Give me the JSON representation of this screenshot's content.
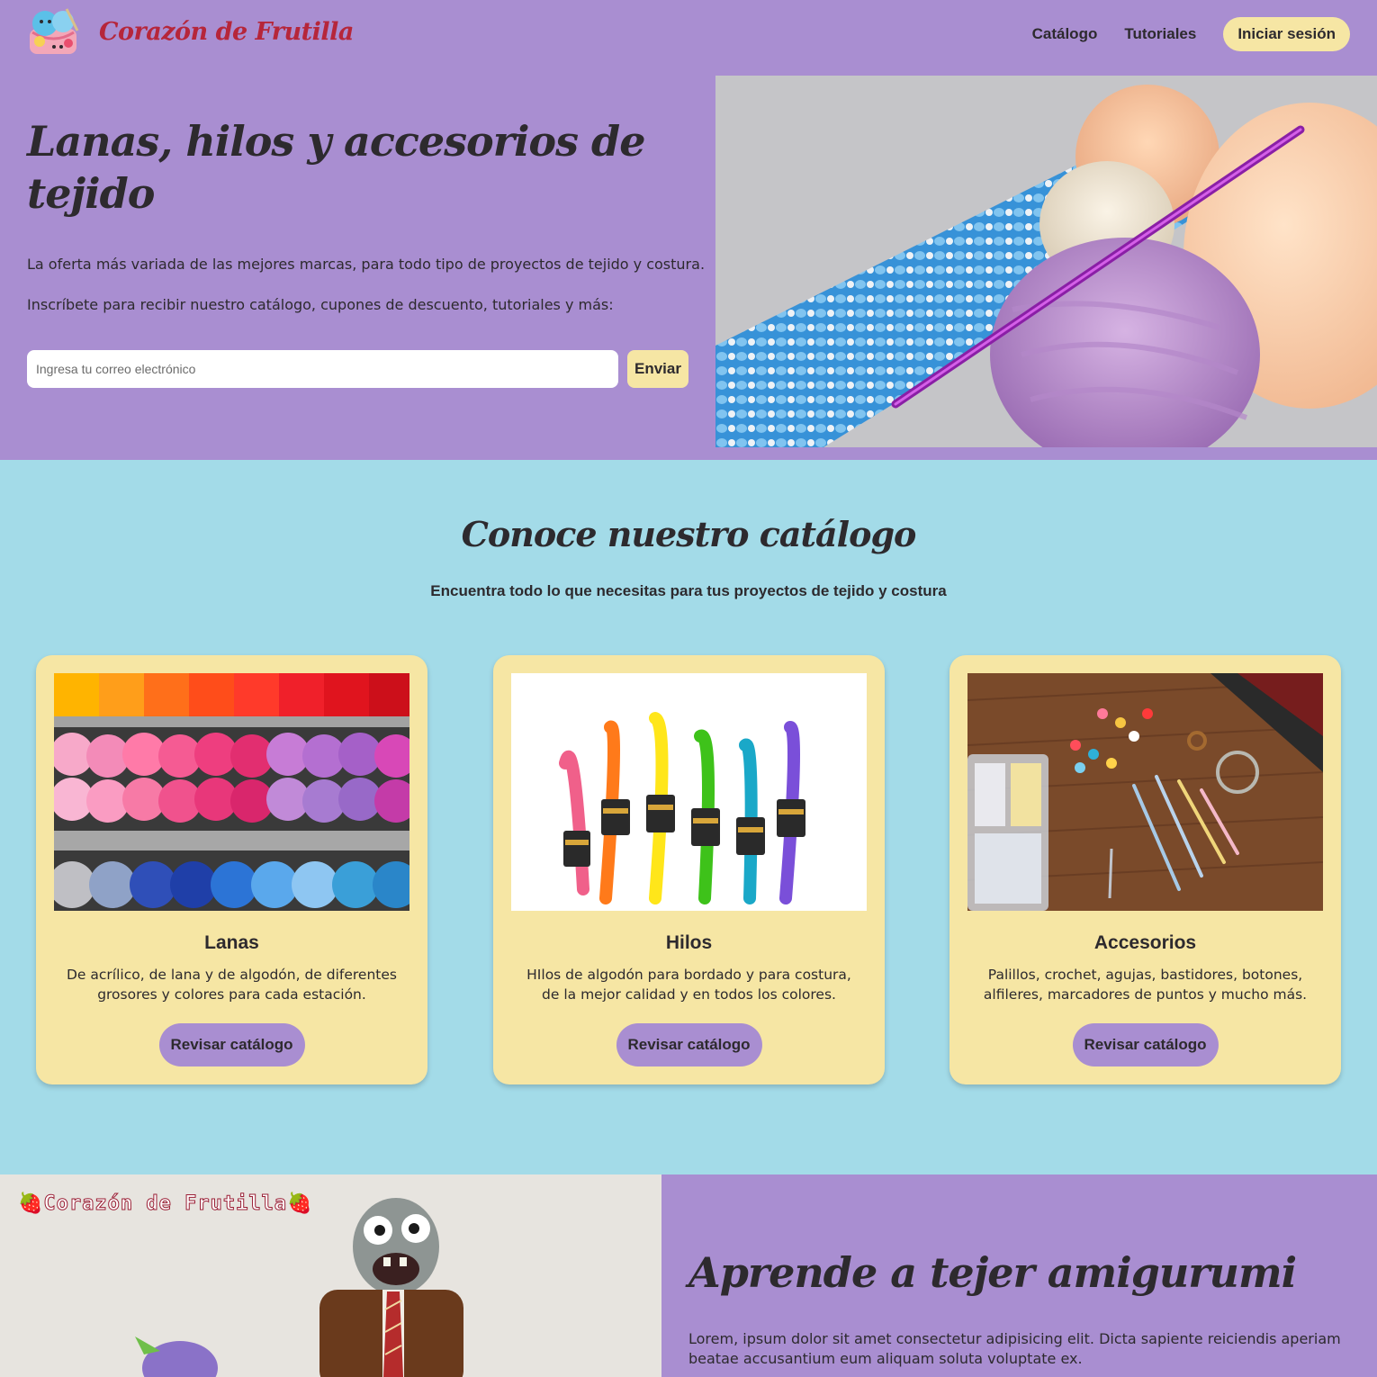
{
  "header": {
    "brand": "Corazón de Frutilla",
    "nav": [
      "Catálogo",
      "Tutoriales"
    ],
    "login_label": "Iniciar sesión"
  },
  "hero": {
    "title": "Lanas, hilos y accesorios de tejido",
    "text1": "La oferta más variada de las mejores marcas, para todo tipo de proyectos de tejido y costura.",
    "text2": "Inscríbete para recibir nuestro catálogo, cupones de descuento, tutoriales y más:",
    "email_placeholder": "Ingresa tu correo electrónico",
    "send_label": "Enviar"
  },
  "catalog": {
    "title": "Conoce nuestro catálogo",
    "subtitle": "Encuentra todo lo que necesitas para tus proyectos de tejido y costura",
    "cards": [
      {
        "title": "Lanas",
        "desc": "De acrílico, de lana y de algodón, de diferentes grosores y colores para cada estación.",
        "button": "Revisar catálogo"
      },
      {
        "title": "Hilos",
        "desc": "HIlos de algodón para bordado y para costura, de la mejor calidad y en todos los colores.",
        "button": "Revisar catálogo"
      },
      {
        "title": "Accesorios",
        "desc": "Palillos, crochet, agujas, bastidores, botones, alfileres, marcadores de puntos y mucho más.",
        "button": "Revisar catálogo"
      }
    ]
  },
  "amigurumi": {
    "watermark": "🍓Corazón de Frutilla🍓",
    "title": "Aprende a tejer amigurumi",
    "text": "Lorem, ipsum dolor sit amet consectetur adipisicing elit. Dicta sapiente reiciendis aperiam beatae accusantium eum aliquam soluta voluptate ex."
  },
  "colors": {
    "purple": "#a98ed1",
    "blue": "#a3dbe8",
    "yellow": "#f6e6a4",
    "brand_red": "#b6263a",
    "text": "#2d2a2e"
  },
  "icons": [
    "yarn-basket-logo-icon"
  ]
}
